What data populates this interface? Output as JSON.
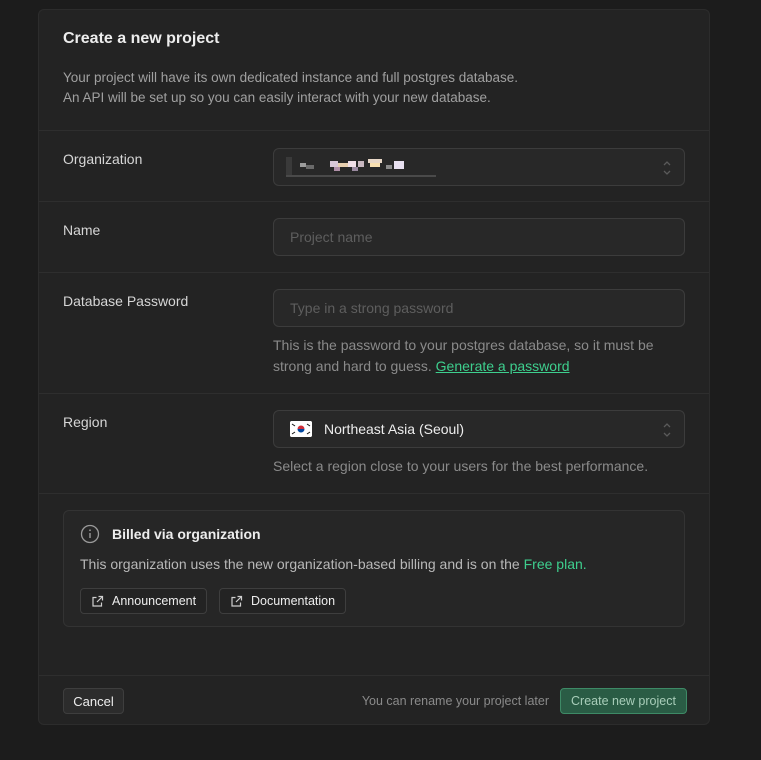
{
  "dialog": {
    "title": "Create a new project",
    "description_line1": "Your project will have its own dedicated instance and full postgres database.",
    "description_line2": "An API will be set up so you can easily interact with your new database."
  },
  "organization": {
    "label": "Organization"
  },
  "name": {
    "label": "Name",
    "placeholder": "Project name",
    "value": ""
  },
  "password": {
    "label": "Database Password",
    "placeholder": "Type in a strong password",
    "value": "",
    "help_text": "This is the password to your postgres database, so it must be strong and hard to guess.",
    "generate_link": "Generate a password"
  },
  "region": {
    "label": "Region",
    "selected": "Northeast Asia (Seoul)",
    "flag_icon": "south-korea-flag-icon",
    "help_text": "Select a region close to your users for the best performance."
  },
  "billing_notice": {
    "title": "Billed via organization",
    "body_prefix": "This organization uses the new organization-based billing and is on the",
    "plan_name": "Free plan.",
    "icon": "info-icon",
    "buttons": [
      {
        "label": "Announcement",
        "icon": "external-link-icon"
      },
      {
        "label": "Documentation",
        "icon": "external-link-icon"
      }
    ]
  },
  "footer": {
    "cancel_label": "Cancel",
    "rename_note": "You can rename your project later",
    "create_label": "Create new project"
  },
  "colors": {
    "background": "#1c1c1c",
    "card": "#232323",
    "accent": "#3ecf8e",
    "primary_button": "#2a5c45"
  }
}
